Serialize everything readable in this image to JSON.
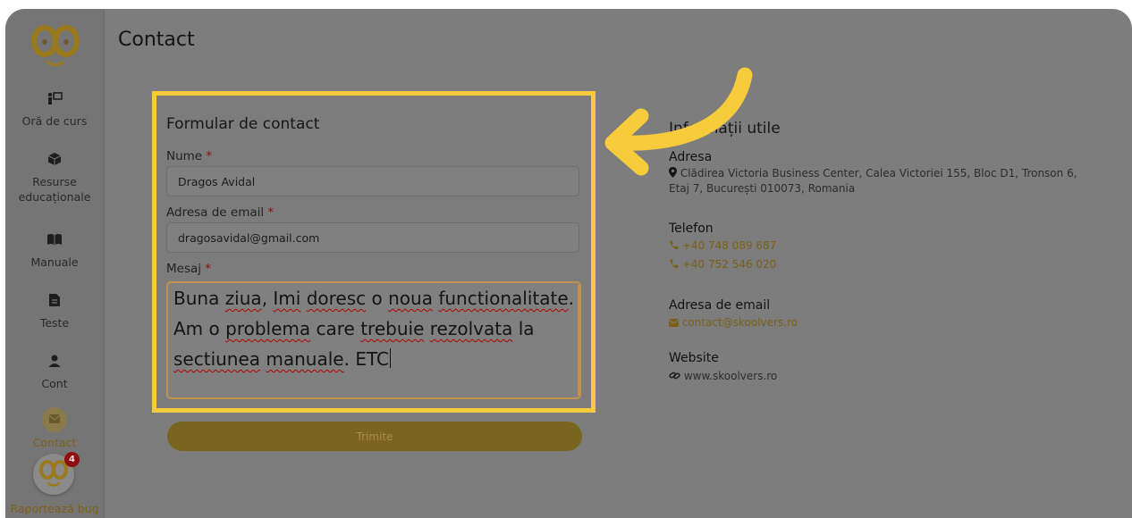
{
  "page_title": "Contact",
  "sidebar": {
    "items": [
      {
        "label": "Oră de curs",
        "icon": "teacher-board-icon"
      },
      {
        "label": "Resurse educaționale",
        "icon": "box-icon"
      },
      {
        "label": "Manuale",
        "icon": "book-icon"
      },
      {
        "label": "Teste",
        "icon": "file-icon"
      },
      {
        "label": "Cont",
        "icon": "user-icon"
      },
      {
        "label": "Contact",
        "icon": "envelope-icon"
      }
    ],
    "bug_label": "Raportează bug",
    "bug_badge": "4"
  },
  "form": {
    "title": "Formular de contact",
    "name_label": "Nume",
    "name_value": "Dragos Avidal",
    "email_label": "Adresa de email",
    "email_value": "dragosavidal@gmail.com",
    "message_label": "Mesaj",
    "message_value": "Buna ziua, Imi doresc o noua functionalitate. Am o problema care trebuie rezolvata la sectiunea manuale. ETC",
    "required_mark": "*",
    "submit_label": "Trimite"
  },
  "info": {
    "title": "Informații utile",
    "address_title": "Adresa",
    "address_line1": "Clădirea Victoria Business Center, Calea Victoriei 155, Bloc D1, Tronson 6,",
    "address_line2": "Etaj 7, București 010073, Romania",
    "phone_title": "Telefon",
    "phone1": "+40 748 089 687",
    "phone2": "+40 752 546 020",
    "email_title": "Adresa de email",
    "email": "contact@skoolvers.ro",
    "website_title": "Website",
    "website": "www.skoolvers.ro"
  },
  "colors": {
    "highlight": "#f6cb3c",
    "accent_dim": "#7a5f14",
    "overlay": "#7d7d7d"
  }
}
